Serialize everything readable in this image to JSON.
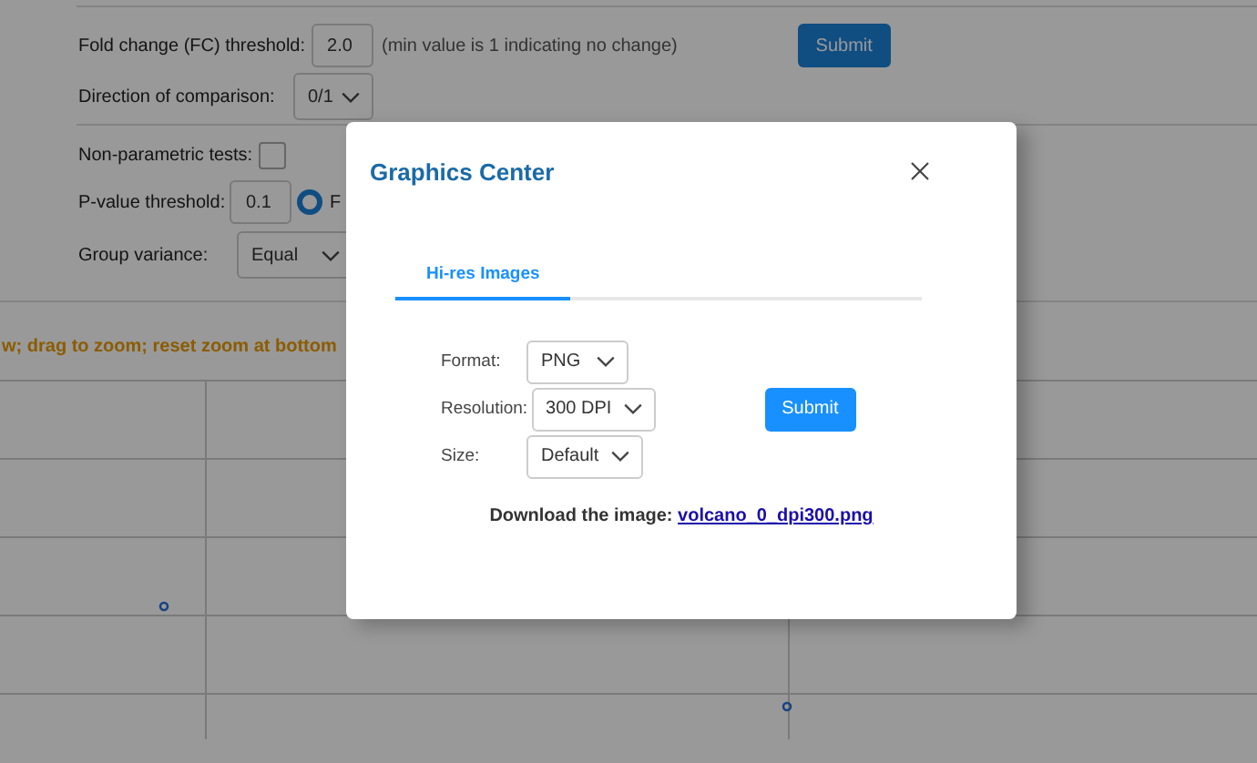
{
  "filters": {
    "fold_change": {
      "label": "Fold change (FC) threshold:",
      "value": "2.0",
      "hint": "(min value is 1 indicating no change)"
    },
    "direction": {
      "label": "Direction of comparison:",
      "value": "0/1"
    },
    "submit": "Submit",
    "nonparametric": {
      "label": "Non-parametric tests:",
      "checked": false
    },
    "p_value": {
      "label": "P-value threshold:",
      "value": "0.1",
      "option": {
        "label": "F",
        "selected": true
      }
    },
    "group_variance": {
      "label": "Group variance:",
      "value": "Equal"
    }
  },
  "plot": {
    "hint": "w; drag to zoom; reset zoom at bottom"
  },
  "dialog": {
    "title": "Graphics Center",
    "tabs": [
      {
        "label": "Hi-res Images",
        "selected": true
      }
    ],
    "fields": [
      {
        "label": "Format:",
        "value": "PNG"
      },
      {
        "label": "Resolution:",
        "value": "300 DPI"
      },
      {
        "label": "Size:",
        "value": "Default"
      }
    ],
    "submit": "Submit",
    "download": {
      "label": "Download the image:",
      "link": "volcano_0_dpi300.png"
    }
  }
}
